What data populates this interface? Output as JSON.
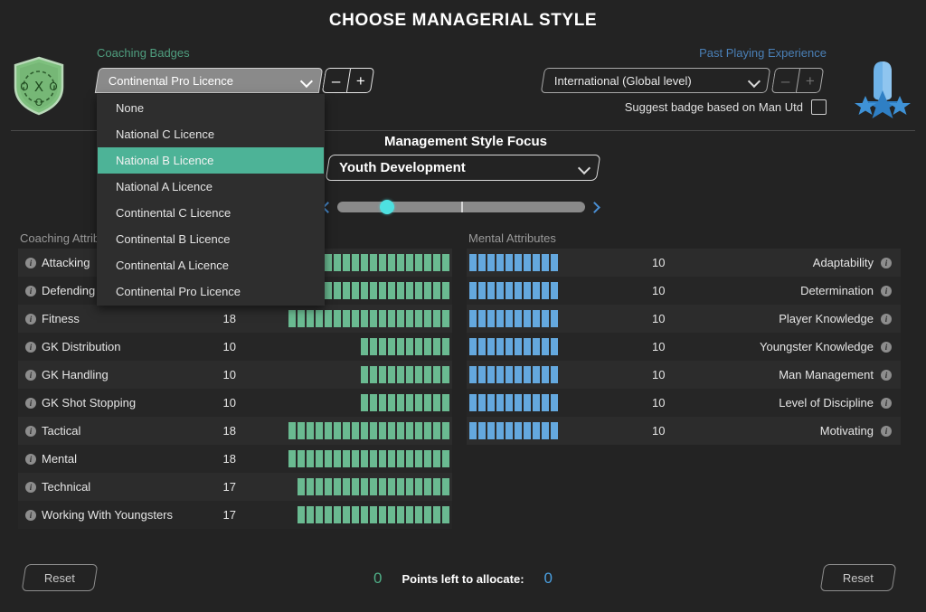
{
  "header": {
    "title": "CHOOSE MANAGERIAL STYLE"
  },
  "coaching_badges": {
    "label": "Coaching Badges",
    "selected": "Continental Pro Licence",
    "badge_icon": "coaching-shield-icon",
    "minus_label": "–",
    "plus_label": "+",
    "options": [
      {
        "label": "None",
        "selected": false
      },
      {
        "label": "National C Licence",
        "selected": false
      },
      {
        "label": "National B Licence",
        "selected": true
      },
      {
        "label": "National A Licence",
        "selected": false
      },
      {
        "label": "Continental C Licence",
        "selected": false
      },
      {
        "label": "Continental B Licence",
        "selected": false
      },
      {
        "label": "Continental A Licence",
        "selected": false
      },
      {
        "label": "Continental Pro Licence",
        "selected": false
      }
    ]
  },
  "past_playing_experience": {
    "label": "Past Playing Experience",
    "selected": "International (Global level)",
    "experience_icon": "player-stars-icon",
    "minus_label": "–",
    "plus_label": "+",
    "suggest_label": "Suggest badge based on Man Utd",
    "suggest_checked": false
  },
  "management_style_focus": {
    "title": "Management Style Focus",
    "selected": "Youth Development",
    "slider_percent": 20
  },
  "coaching_attributes": {
    "title": "Coaching Attributes",
    "max": 20,
    "rows": [
      {
        "name": "Attacking",
        "value": 18
      },
      {
        "name": "Defending",
        "value": 18
      },
      {
        "name": "Fitness",
        "value": 18
      },
      {
        "name": "GK Distribution",
        "value": 10
      },
      {
        "name": "GK Handling",
        "value": 10
      },
      {
        "name": "GK Shot Stopping",
        "value": 10
      },
      {
        "name": "Tactical",
        "value": 18
      },
      {
        "name": "Mental",
        "value": 18
      },
      {
        "name": "Technical",
        "value": 17
      },
      {
        "name": "Working With Youngsters",
        "value": 17
      }
    ]
  },
  "mental_attributes": {
    "title": "Mental Attributes",
    "max": 20,
    "rows": [
      {
        "name": "Adaptability",
        "value": 10
      },
      {
        "name": "Determination",
        "value": 10
      },
      {
        "name": "Player Knowledge",
        "value": 10
      },
      {
        "name": "Youngster Knowledge",
        "value": 10
      },
      {
        "name": "Man Management",
        "value": 10
      },
      {
        "name": "Level of Discipline",
        "value": 10
      },
      {
        "name": "Motivating",
        "value": 10
      }
    ]
  },
  "footer": {
    "reset_left_label": "Reset",
    "reset_right_label": "Reset",
    "points_coaching": "0",
    "points_label": "Points left to allocate:",
    "points_mental": "0"
  },
  "colors": {
    "accent_green": "#4db397",
    "bar_green": "#6aba91",
    "bar_blue": "#64a8de",
    "slider_thumb": "#4ee0e0",
    "badge_label": "#4f9e7f",
    "experience_label": "#4a7fb5"
  }
}
